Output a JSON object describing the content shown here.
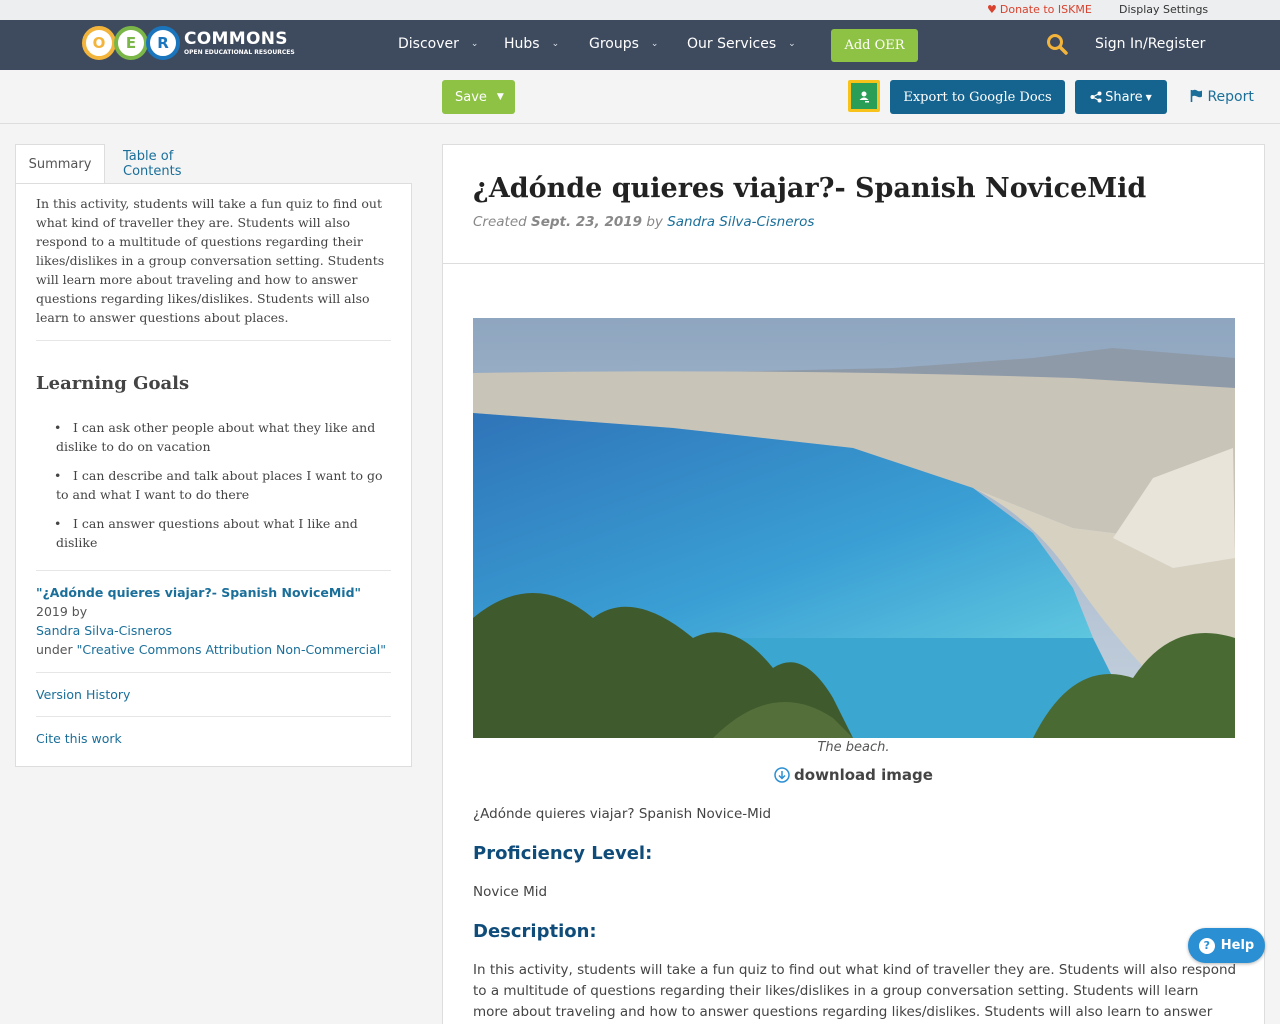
{
  "utility": {
    "donate": "Donate to ISKME",
    "display_settings": "Display Settings"
  },
  "nav": {
    "logo_letters": [
      "O",
      "E",
      "R"
    ],
    "logo_colors": [
      "#f3b43b",
      "#7ab648",
      "#1b75bc"
    ],
    "logo_title": "COMMONS",
    "logo_subtitle": "OPEN EDUCATIONAL RESOURCES",
    "items": [
      "Discover",
      "Hubs",
      "Groups",
      "Our Services"
    ],
    "add_oer": "Add OER",
    "sign_in": "Sign In/Register"
  },
  "toolbar": {
    "save": "Save",
    "export": "Export to Google Docs",
    "share": "Share",
    "report": "Report"
  },
  "tabs": {
    "summary": "Summary",
    "toc": "Table of Contents"
  },
  "summary": {
    "text": "In this activity, students will take a fun quiz to find out what kind of traveller they are. Students will also respond to a multitude of questions regarding their likes/dislikes in a group conversation setting. Students will learn more about traveling and how to answer questions regarding likes/dislikes. Students will also learn to answer questions about places.",
    "goals_title": "Learning Goals",
    "goals": [
      "I can ask other people about what they like and dislike to do on vacation",
      "I can describe and talk about places I want to go to and what I want to do there",
      "I can answer questions about what I like and dislike"
    ],
    "cite_title": "\"¿Adónde quieres viajar?- Spanish NoviceMid\"",
    "cite_year": " 2019 by",
    "cite_author": "Sandra Silva-Cisneros",
    "cite_under": "under ",
    "cite_license": "\"Creative Commons Attribution Non-Commercial\"",
    "version_history": "Version History",
    "cite_work": "Cite this work"
  },
  "content": {
    "title": "¿Adónde quieres viajar?- Spanish NoviceMid",
    "created_label": "Created ",
    "created_date": "Sept. 23, 2019",
    "by_label": " by ",
    "author": "Sandra Silva-Cisneros",
    "caption": "The beach.",
    "download": "download image",
    "intro": "¿Adónde quieres viajar? Spanish Novice-Mid",
    "proficiency_heading": "Proficiency Level:",
    "proficiency_value": "Novice Mid",
    "description_heading": "Description:",
    "description_text": "In this activity, students will take a fun quiz to find out what kind of traveller they are. Students will also respond to a multitude of questions regarding their likes/dislikes in a group conversation setting. Students will learn more about traveling and how to answer questions regarding likes/dislikes. Students will also learn to answer questions"
  },
  "help": "Help"
}
